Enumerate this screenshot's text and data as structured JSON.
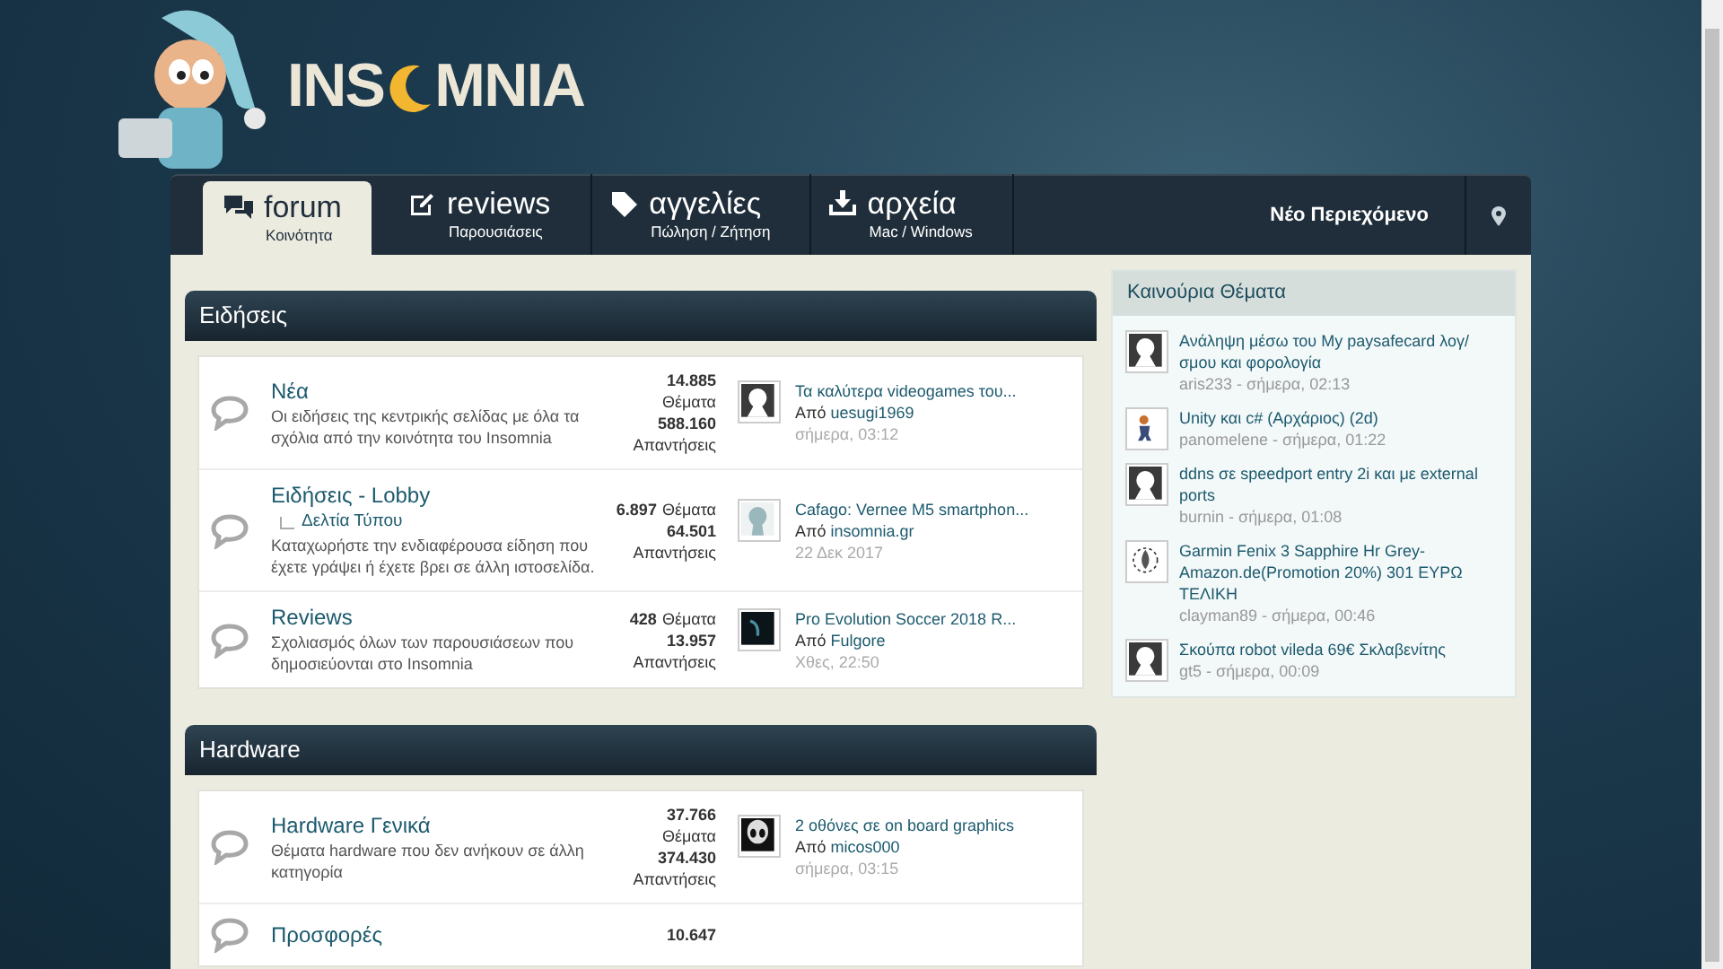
{
  "logo": {
    "left": "INS",
    "right": "MNIA"
  },
  "nav": {
    "tabs": [
      {
        "kind": "chat",
        "label": "forum",
        "sub": "Κοινότητα",
        "selected": true
      },
      {
        "kind": "edit",
        "label": "reviews",
        "sub": "Παρουσιάσεις",
        "selected": false
      },
      {
        "kind": "tag",
        "label": "αγγελίες",
        "sub": "Πώληση / Ζήτηση",
        "selected": false
      },
      {
        "kind": "download",
        "label": "αρχεία",
        "sub": "Mac / Windows",
        "selected": false
      }
    ],
    "new_content": "Νέο Περιεχόμενο"
  },
  "categories": [
    {
      "title": "Ειδήσεις",
      "forums": [
        {
          "title": "Νέα",
          "description": "Οι ειδήσεις της κεντρικής σελίδας με όλα τα σχόλια από την κοινότητα του Insomnia",
          "threads": "14.885",
          "threads_label": "Θέματα",
          "replies": "588.160",
          "replies_label": "Απαντήσεις",
          "last_title": "Τα καλύτερα videogames του...",
          "last_by": "Από",
          "last_user": "uesugi1969",
          "last_time": "σήμερα, 03:12",
          "kind": "silhouette"
        },
        {
          "title": "Ειδήσεις - Lobby",
          "subforum": "Δελτία Τύπου",
          "description": "Καταχωρήστε την ενδιαφέρουσα είδηση που έχετε γράψει ή έχετε βρει σε άλλη ιστοσελίδα.",
          "threads": "6.897",
          "threads_label": "Θέματα",
          "replies": "64.501",
          "replies_label": "Απαντήσεις",
          "last_title": "Cafago: Vernee M5 smartphon...",
          "last_by": "Από",
          "last_user": "insomnia.gr",
          "last_time": "22 Δεκ 2017",
          "kind": "light"
        },
        {
          "title": "Reviews",
          "description": "Σχολιασμός όλων των παρουσιάσεων που δημοσιεύονται στο Insomnia",
          "threads": "428",
          "threads_label": "Θέματα",
          "replies": "13.957",
          "replies_label": "Απαντήσεις",
          "last_title": "Pro Evolution Soccer 2018 R...",
          "last_by": "Από",
          "last_user": "Fulgore",
          "last_time": "Χθες, 22:50",
          "kind": "dark"
        }
      ]
    },
    {
      "title": "Hardware",
      "forums": [
        {
          "title": "Hardware Γενικά",
          "description": "Θέματα hardware που δεν ανήκουν σε άλλη κατηγορία",
          "threads": "37.766",
          "threads_label": "Θέματα",
          "replies": "374.430",
          "replies_label": "Απαντήσεις",
          "last_title": "2 οθόνες σε on board graphics",
          "last_by": "Από",
          "last_user": "micos000",
          "last_time": "σήμερα, 03:15",
          "kind": "alien"
        },
        {
          "title": "Προσφορές",
          "threads": "10.647"
        }
      ]
    }
  ],
  "sidebar": {
    "title": "Καινούρια Θέματα",
    "topics": [
      {
        "title": "Ανάληψη μέσω του My paysafecard λογ/σμου και φορολογία",
        "meta": "aris233 - σήμερα, 02:13",
        "kind": "silhouette"
      },
      {
        "title": "Unity και c# (Αρχάριος) (2d)",
        "meta": "panomelene - σήμερα, 01:22",
        "kind": "figure"
      },
      {
        "title": "ddns σε speedport entry 2i και με external ports",
        "meta": "burnin - σήμερα, 01:08",
        "kind": "silhouette"
      },
      {
        "title": "Garmin Fenix 3 Sapphire Hr Grey-Amazon.de(Promotion 20%) 301 ΕΥΡΩ ΤΕΛΙΚΗ",
        "meta": "clayman89 - σήμερα, 00:46",
        "kind": "emblem"
      },
      {
        "title": "Σκούπα robot vileda 69€ Σκλαβενίτης",
        "meta": "gt5 - σήμερα, 00:09",
        "kind": "silhouette"
      }
    ]
  }
}
